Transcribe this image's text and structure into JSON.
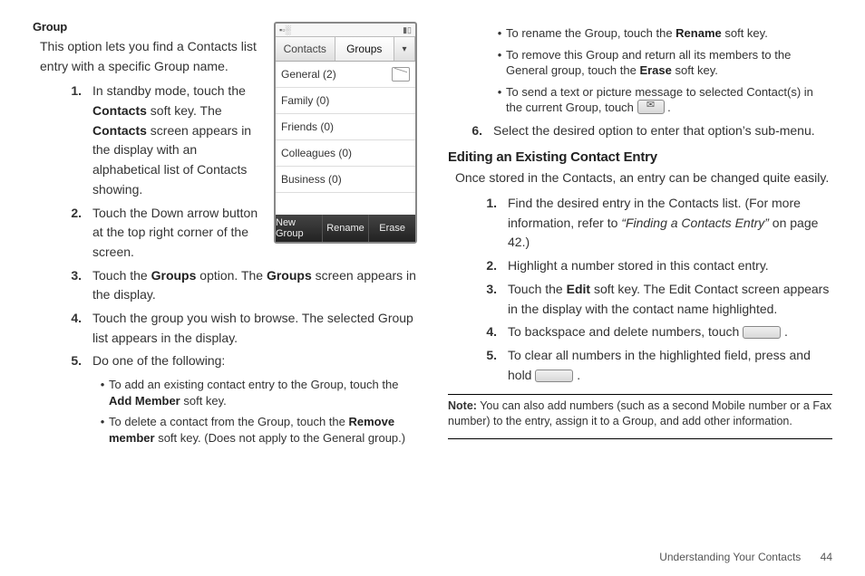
{
  "left": {
    "heading": "Group",
    "intro": "This option lets you find a Contacts list entry with a specific Group name.",
    "steps": [
      {
        "num": "1.",
        "pre": "In standby mode, touch the ",
        "b": "Contacts",
        "mid": " soft key. The ",
        "b2": "Contacts",
        "post": " screen appears in the display with an alphabetical list of Contacts showing.",
        "tight": true
      },
      {
        "num": "2.",
        "text": "Touch the Down arrow button at the top right corner of the screen.",
        "tight": true
      },
      {
        "num": "3.",
        "pre": "Touch the ",
        "b": "Groups",
        "mid": " option. The ",
        "b2": "Groups",
        "post": " screen appears in the display."
      },
      {
        "num": "4.",
        "text": "Touch the group you wish to browse. The selected Group list appears in the display."
      },
      {
        "num": "5.",
        "text": "Do one of the following:"
      }
    ],
    "bullets": [
      {
        "pre": "To add an existing contact entry to the Group, touch the ",
        "b": "Add Member",
        "post": " soft key."
      },
      {
        "pre": "To delete a contact from the Group, touch the ",
        "b": "Remove member",
        "post": " soft key. (Does not apply to the General group.)"
      }
    ]
  },
  "phone": {
    "tab_contacts": "Contacts",
    "tab_groups": "Groups",
    "rows": [
      "General (2)",
      "Family (0)",
      "Friends (0)",
      "Colleagues (0)",
      "Business (0)"
    ],
    "sk": [
      "New Group",
      "Rename",
      "Erase"
    ]
  },
  "right": {
    "bullets_top": [
      {
        "pre": "To rename the Group, touch the ",
        "b": "Rename",
        "post": " soft key."
      },
      {
        "pre": "To remove this Group and return all its members to the General group, touch the ",
        "b": "Erase",
        "post": " soft key."
      },
      {
        "pre": "To send a text or picture message to selected Contact(s) in the current Group, touch ",
        "icon": "envelope",
        "post": " ."
      }
    ],
    "step6": {
      "num": "6.",
      "text": "Select the desired option to enter that option’s sub-menu."
    },
    "edit_heading": "Editing an Existing Contact Entry",
    "edit_intro": "Once stored in the Contacts, an entry can be changed quite easily.",
    "edit_steps": [
      {
        "num": "1.",
        "pre": "Find the desired entry in the Contacts list. (For more information, refer to ",
        "i": "“Finding a Contacts Entry”",
        "post": "  on page 42.)"
      },
      {
        "num": "2.",
        "text": "Highlight a number stored in this contact entry."
      },
      {
        "num": "3.",
        "pre": "Touch the ",
        "b": "Edit",
        "post": " soft key. The Edit Contact screen appears in the display with the contact name highlighted."
      },
      {
        "num": "4.",
        "pre": "To backspace and delete numbers, touch ",
        "icon": "backspace",
        "post": " ."
      },
      {
        "num": "5.",
        "pre": "To clear all numbers in the highlighted field, press and hold ",
        "icon": "hold",
        "post": " ."
      }
    ],
    "note_label": "Note:",
    "note_text": " You can also add numbers (such as a second Mobile number or a Fax number) to the entry, assign it to a Group, and add other information."
  },
  "footer": {
    "section": "Understanding Your Contacts",
    "page": "44"
  }
}
